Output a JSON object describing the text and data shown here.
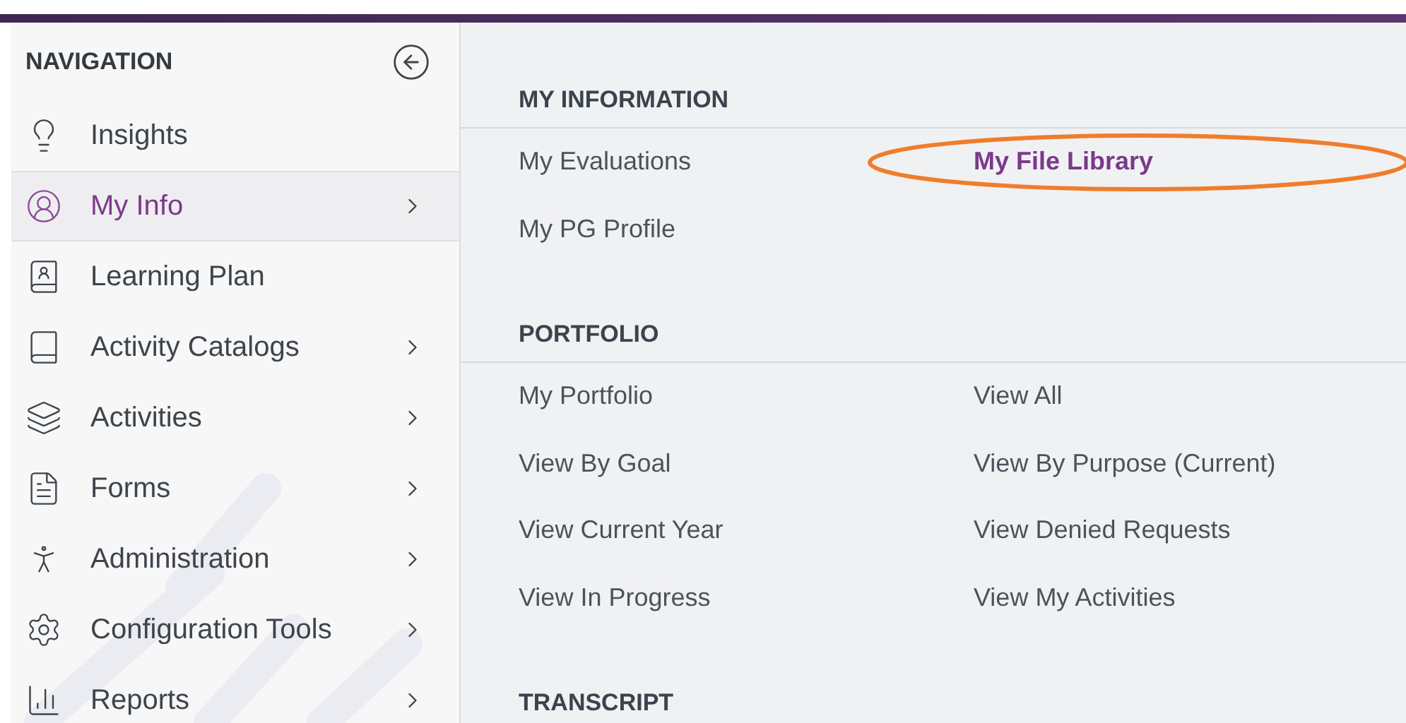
{
  "sidebar": {
    "title": "NAVIGATION",
    "items": [
      {
        "label": "Insights",
        "selected": false,
        "has_submenu": false
      },
      {
        "label": "My Info",
        "selected": true,
        "has_submenu": true
      },
      {
        "label": "Learning Plan",
        "selected": false,
        "has_submenu": false
      },
      {
        "label": "Activity Catalogs",
        "selected": false,
        "has_submenu": true
      },
      {
        "label": "Activities",
        "selected": false,
        "has_submenu": true
      },
      {
        "label": "Forms",
        "selected": false,
        "has_submenu": true
      },
      {
        "label": "Administration",
        "selected": false,
        "has_submenu": true
      },
      {
        "label": "Configuration Tools",
        "selected": false,
        "has_submenu": true
      },
      {
        "label": "Reports",
        "selected": false,
        "has_submenu": true
      }
    ]
  },
  "sections": [
    {
      "title": "MY INFORMATION",
      "links": [
        {
          "label": "My Evaluations",
          "highlighted": false
        },
        {
          "label": "My File Library",
          "highlighted": true
        },
        {
          "label": "My PG Profile",
          "highlighted": false
        }
      ]
    },
    {
      "title": "PORTFOLIO",
      "links": [
        {
          "label": "My Portfolio",
          "highlighted": false
        },
        {
          "label": "View All",
          "highlighted": false
        },
        {
          "label": "View By Goal",
          "highlighted": false
        },
        {
          "label": "View By Purpose (Current)",
          "highlighted": false
        },
        {
          "label": "View Current Year",
          "highlighted": false
        },
        {
          "label": "View Denied Requests",
          "highlighted": false
        },
        {
          "label": "View In Progress",
          "highlighted": false
        },
        {
          "label": "View My Activities",
          "highlighted": false
        }
      ]
    },
    {
      "title": "TRANSCRIPT"
    }
  ]
}
